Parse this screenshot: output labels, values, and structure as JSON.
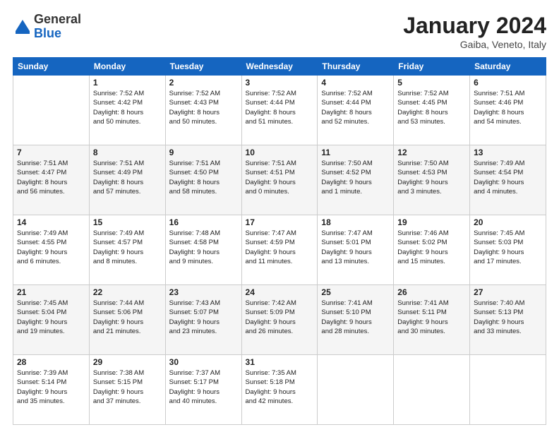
{
  "header": {
    "logo_general": "General",
    "logo_blue": "Blue",
    "month_title": "January 2024",
    "location": "Gaiba, Veneto, Italy"
  },
  "weekdays": [
    "Sunday",
    "Monday",
    "Tuesday",
    "Wednesday",
    "Thursday",
    "Friday",
    "Saturday"
  ],
  "weeks": [
    [
      {
        "day": "",
        "info": ""
      },
      {
        "day": "1",
        "info": "Sunrise: 7:52 AM\nSunset: 4:42 PM\nDaylight: 8 hours\nand 50 minutes."
      },
      {
        "day": "2",
        "info": "Sunrise: 7:52 AM\nSunset: 4:43 PM\nDaylight: 8 hours\nand 50 minutes."
      },
      {
        "day": "3",
        "info": "Sunrise: 7:52 AM\nSunset: 4:44 PM\nDaylight: 8 hours\nand 51 minutes."
      },
      {
        "day": "4",
        "info": "Sunrise: 7:52 AM\nSunset: 4:44 PM\nDaylight: 8 hours\nand 52 minutes."
      },
      {
        "day": "5",
        "info": "Sunrise: 7:52 AM\nSunset: 4:45 PM\nDaylight: 8 hours\nand 53 minutes."
      },
      {
        "day": "6",
        "info": "Sunrise: 7:51 AM\nSunset: 4:46 PM\nDaylight: 8 hours\nand 54 minutes."
      }
    ],
    [
      {
        "day": "7",
        "info": "Sunrise: 7:51 AM\nSunset: 4:47 PM\nDaylight: 8 hours\nand 56 minutes."
      },
      {
        "day": "8",
        "info": "Sunrise: 7:51 AM\nSunset: 4:49 PM\nDaylight: 8 hours\nand 57 minutes."
      },
      {
        "day": "9",
        "info": "Sunrise: 7:51 AM\nSunset: 4:50 PM\nDaylight: 8 hours\nand 58 minutes."
      },
      {
        "day": "10",
        "info": "Sunrise: 7:51 AM\nSunset: 4:51 PM\nDaylight: 9 hours\nand 0 minutes."
      },
      {
        "day": "11",
        "info": "Sunrise: 7:50 AM\nSunset: 4:52 PM\nDaylight: 9 hours\nand 1 minute."
      },
      {
        "day": "12",
        "info": "Sunrise: 7:50 AM\nSunset: 4:53 PM\nDaylight: 9 hours\nand 3 minutes."
      },
      {
        "day": "13",
        "info": "Sunrise: 7:49 AM\nSunset: 4:54 PM\nDaylight: 9 hours\nand 4 minutes."
      }
    ],
    [
      {
        "day": "14",
        "info": "Sunrise: 7:49 AM\nSunset: 4:55 PM\nDaylight: 9 hours\nand 6 minutes."
      },
      {
        "day": "15",
        "info": "Sunrise: 7:49 AM\nSunset: 4:57 PM\nDaylight: 9 hours\nand 8 minutes."
      },
      {
        "day": "16",
        "info": "Sunrise: 7:48 AM\nSunset: 4:58 PM\nDaylight: 9 hours\nand 9 minutes."
      },
      {
        "day": "17",
        "info": "Sunrise: 7:47 AM\nSunset: 4:59 PM\nDaylight: 9 hours\nand 11 minutes."
      },
      {
        "day": "18",
        "info": "Sunrise: 7:47 AM\nSunset: 5:01 PM\nDaylight: 9 hours\nand 13 minutes."
      },
      {
        "day": "19",
        "info": "Sunrise: 7:46 AM\nSunset: 5:02 PM\nDaylight: 9 hours\nand 15 minutes."
      },
      {
        "day": "20",
        "info": "Sunrise: 7:45 AM\nSunset: 5:03 PM\nDaylight: 9 hours\nand 17 minutes."
      }
    ],
    [
      {
        "day": "21",
        "info": "Sunrise: 7:45 AM\nSunset: 5:04 PM\nDaylight: 9 hours\nand 19 minutes."
      },
      {
        "day": "22",
        "info": "Sunrise: 7:44 AM\nSunset: 5:06 PM\nDaylight: 9 hours\nand 21 minutes."
      },
      {
        "day": "23",
        "info": "Sunrise: 7:43 AM\nSunset: 5:07 PM\nDaylight: 9 hours\nand 23 minutes."
      },
      {
        "day": "24",
        "info": "Sunrise: 7:42 AM\nSunset: 5:09 PM\nDaylight: 9 hours\nand 26 minutes."
      },
      {
        "day": "25",
        "info": "Sunrise: 7:41 AM\nSunset: 5:10 PM\nDaylight: 9 hours\nand 28 minutes."
      },
      {
        "day": "26",
        "info": "Sunrise: 7:41 AM\nSunset: 5:11 PM\nDaylight: 9 hours\nand 30 minutes."
      },
      {
        "day": "27",
        "info": "Sunrise: 7:40 AM\nSunset: 5:13 PM\nDaylight: 9 hours\nand 33 minutes."
      }
    ],
    [
      {
        "day": "28",
        "info": "Sunrise: 7:39 AM\nSunset: 5:14 PM\nDaylight: 9 hours\nand 35 minutes."
      },
      {
        "day": "29",
        "info": "Sunrise: 7:38 AM\nSunset: 5:15 PM\nDaylight: 9 hours\nand 37 minutes."
      },
      {
        "day": "30",
        "info": "Sunrise: 7:37 AM\nSunset: 5:17 PM\nDaylight: 9 hours\nand 40 minutes."
      },
      {
        "day": "31",
        "info": "Sunrise: 7:35 AM\nSunset: 5:18 PM\nDaylight: 9 hours\nand 42 minutes."
      },
      {
        "day": "",
        "info": ""
      },
      {
        "day": "",
        "info": ""
      },
      {
        "day": "",
        "info": ""
      }
    ]
  ]
}
